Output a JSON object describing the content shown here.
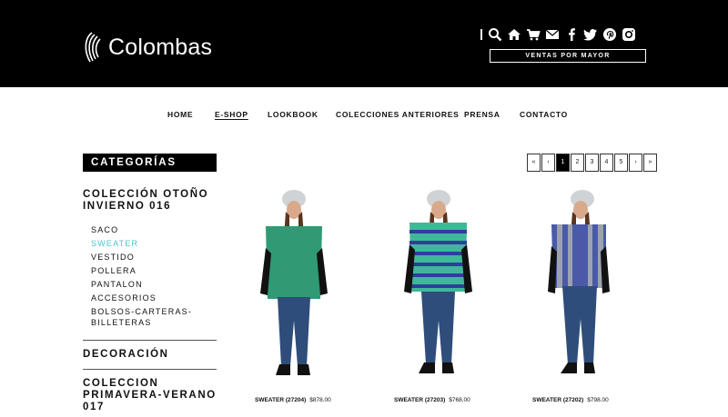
{
  "brand": {
    "name": "Colombas"
  },
  "header": {
    "icons": [
      "search-icon",
      "home-icon",
      "cart-icon",
      "mail-icon",
      "facebook-icon",
      "twitter-icon",
      "pinterest-icon",
      "instagram-icon"
    ],
    "ventas_label": "VENTAS POR MAYOR"
  },
  "nav": {
    "items": [
      "HOME",
      "E-SHOP",
      "LOOKBOOK",
      "COLECCIONES ANTERIORES",
      "PRENSA",
      "CONTACTO"
    ],
    "active": "E-SHOP"
  },
  "sidebar": {
    "heading": "CATEGORÍAS",
    "section1": {
      "title": [
        "COLECCIÓN OTOÑO",
        "INVIERNO 016"
      ],
      "items": [
        "SACO",
        "SWEATER",
        "VESTIDO",
        "POLLERA",
        "PANTALON",
        "ACCESORIOS",
        [
          "BOLSOS-CARTERAS-",
          "BILLETERAS"
        ]
      ],
      "active": "SWEATER"
    },
    "section2": {
      "title": "DECORACIÓN"
    },
    "section3": {
      "title": [
        "COLECCION",
        "PRIMAVERA-VERANO",
        "017"
      ]
    }
  },
  "pager": {
    "first": "«",
    "prev": "‹",
    "pages": [
      "1",
      "2",
      "3",
      "4",
      "5"
    ],
    "current": "1",
    "next": "›",
    "last": "»"
  },
  "products": [
    {
      "name": "SWEATER (27204)",
      "price": "$878.00",
      "sweater_color": "#2f9a73"
    },
    {
      "name": "SWEATER (27203)",
      "price": "$768.00",
      "sweater_color": "#3fb89a"
    },
    {
      "name": "SWEATER (27202)",
      "price": "$798.00",
      "sweater_color": "#4a5aa8"
    }
  ],
  "colors": {
    "accent": "#4dc2cc",
    "header_bg": "#000000"
  }
}
